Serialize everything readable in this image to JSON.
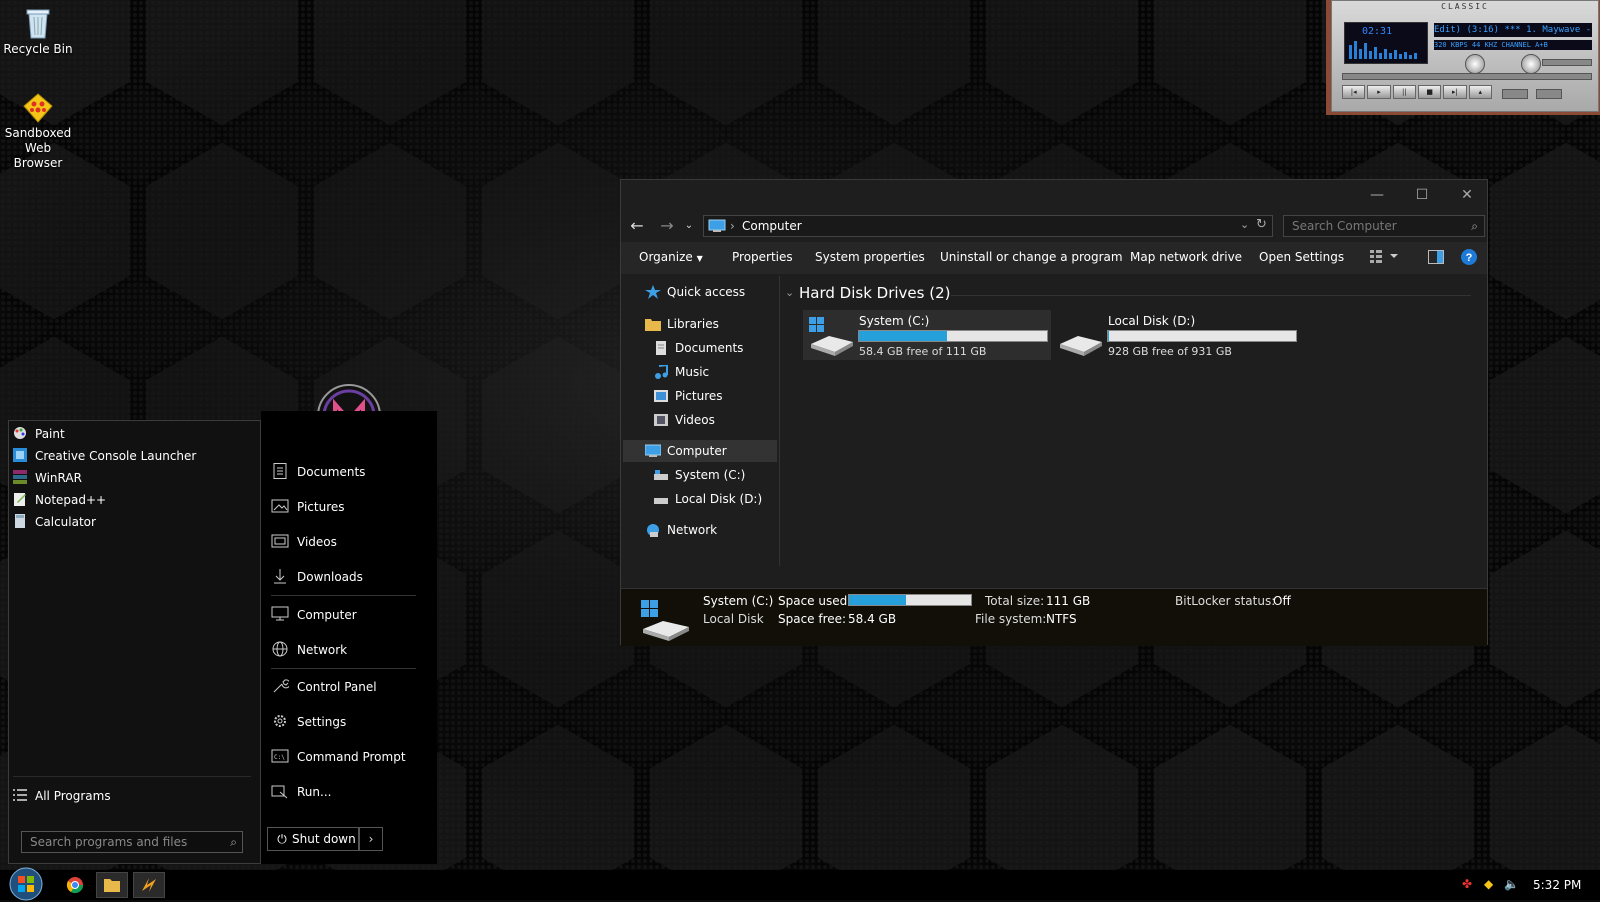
{
  "desktop": {
    "icons": [
      {
        "label": "Recycle Bin",
        "icon": "recycle-bin-icon"
      },
      {
        "label": "Sandboxed Web Browser",
        "icon": "sandboxed-browser-icon"
      }
    ]
  },
  "winamp": {
    "title": "CLASSIC",
    "time": "02:31",
    "marquee": "Edit) (3:16) *** 1. Maywave - Co",
    "kbps": "320 KBPS  44 KHZ   CHANNEL   A+B"
  },
  "explorer": {
    "breadcrumb": "Computer",
    "search_placeholder": "Search Computer",
    "commands": [
      "Organize",
      "Properties",
      "System properties",
      "Uninstall or change a program",
      "Map network drive",
      "Open Settings"
    ],
    "nav": {
      "quick_access": "Quick access",
      "libraries": "Libraries",
      "documents": "Documents",
      "music": "Music",
      "pictures": "Pictures",
      "videos": "Videos",
      "computer": "Computer",
      "system_c": "System (C:)",
      "local_d": "Local Disk (D:)",
      "network": "Network"
    },
    "group_title": "Hard Disk Drives (2)",
    "drives": [
      {
        "name": "System (C:)",
        "free": "58.4 GB free of 111 GB",
        "used_fraction": 0.47
      },
      {
        "name": "Local Disk (D:)",
        "free": "928 GB free of 931 GB",
        "used_fraction": 0.003
      }
    ],
    "details": {
      "name": "System (C:)",
      "type": "Local Disk",
      "space_used_label": "Space used:",
      "space_free_label": "Space free:",
      "space_free": "58.4 GB",
      "used_fraction": 0.47,
      "total_label": "Total size:",
      "total": "111 GB",
      "fs_label": "File system:",
      "fs": "NTFS",
      "bitlocker_label": "BitLocker status:",
      "bitlocker": "Off"
    }
  },
  "start_menu": {
    "programs": [
      "Paint",
      "Creative Console Launcher",
      "WinRAR",
      "Notepad++",
      "Calculator"
    ],
    "all_programs": "All Programs",
    "search_placeholder": "Search programs and files",
    "links": [
      "Documents",
      "Pictures",
      "Videos",
      "Downloads",
      "Computer",
      "Network",
      "Control Panel",
      "Settings",
      "Command Prompt",
      "Run..."
    ],
    "shutdown": "Shut down"
  },
  "taskbar": {
    "clock": "5:32 PM"
  },
  "colors": {
    "accent": "#26a0da",
    "help": "#1e7ad9"
  }
}
